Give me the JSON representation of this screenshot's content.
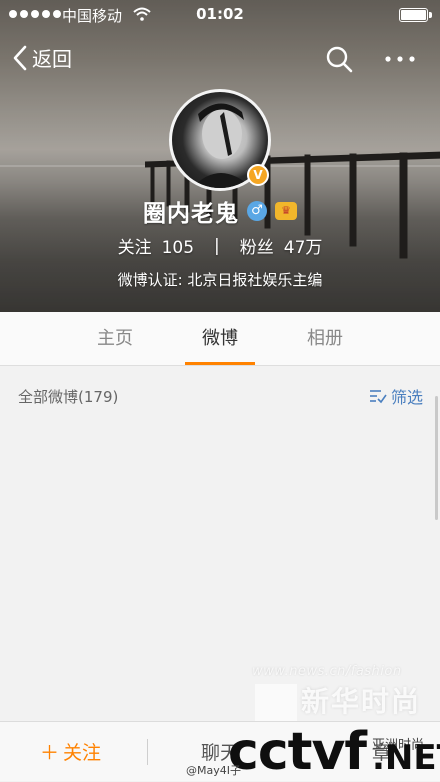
{
  "status_bar": {
    "carrier": "中国移动",
    "time": "01:02"
  },
  "nav": {
    "back_label": "返回"
  },
  "profile": {
    "name": "圈内老鬼",
    "verified_symbol": "V",
    "following_label": "关注",
    "following_count": "105",
    "stats_separator": "|",
    "followers_label": "粉丝",
    "followers_count": "47万",
    "verification": "微博认证: 北京日报社娱乐主编"
  },
  "tabs": [
    {
      "label": "主页",
      "active": false
    },
    {
      "label": "微博",
      "active": true
    },
    {
      "label": "相册",
      "active": false
    }
  ],
  "feed": {
    "count_label": "全部微博(179)",
    "filter_label": "筛选"
  },
  "bottom_bar": {
    "follow_label": "关注",
    "chat_label": "聊天",
    "article_label": "章"
  },
  "watermarks": {
    "site": "www.news.cn/fashion",
    "xinhua": "新华时尚",
    "cctv": "cctvf",
    "cctv_net": ".NET",
    "asia": "亚洲时尚",
    "weibo": "@May4Ⅰ子"
  },
  "colors": {
    "accent": "#ff8200",
    "link": "#4a7fbf",
    "badge": "#f5a623"
  }
}
